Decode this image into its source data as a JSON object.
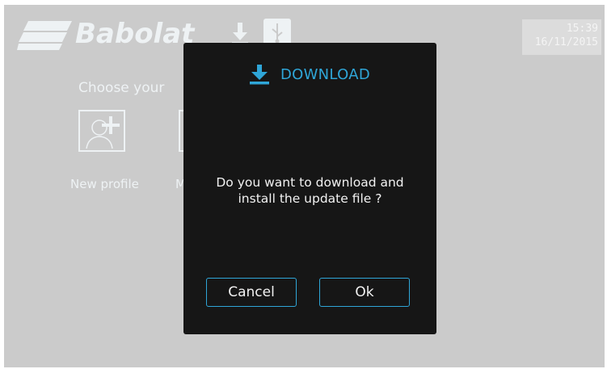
{
  "header": {
    "brand": "Babolat",
    "icons": [
      "download-icon",
      "usb-icon"
    ],
    "clock_time": "15:39",
    "clock_date": "16/11/2015"
  },
  "main": {
    "choose_label": "Choose your",
    "profiles": [
      {
        "label": "New profile",
        "icon": "add-user-icon"
      },
      {
        "label": "M"
      }
    ]
  },
  "dialog": {
    "title": "DOWNLOAD",
    "title_icon": "download-icon",
    "message_line1": "Do you want to download and",
    "message_line2": "install the update file ?",
    "cancel_label": "Cancel",
    "ok_label": "Ok"
  },
  "colors": {
    "background": "#cbcbcb",
    "dialog_background": "#161616",
    "accent": "#2fa6d8"
  }
}
